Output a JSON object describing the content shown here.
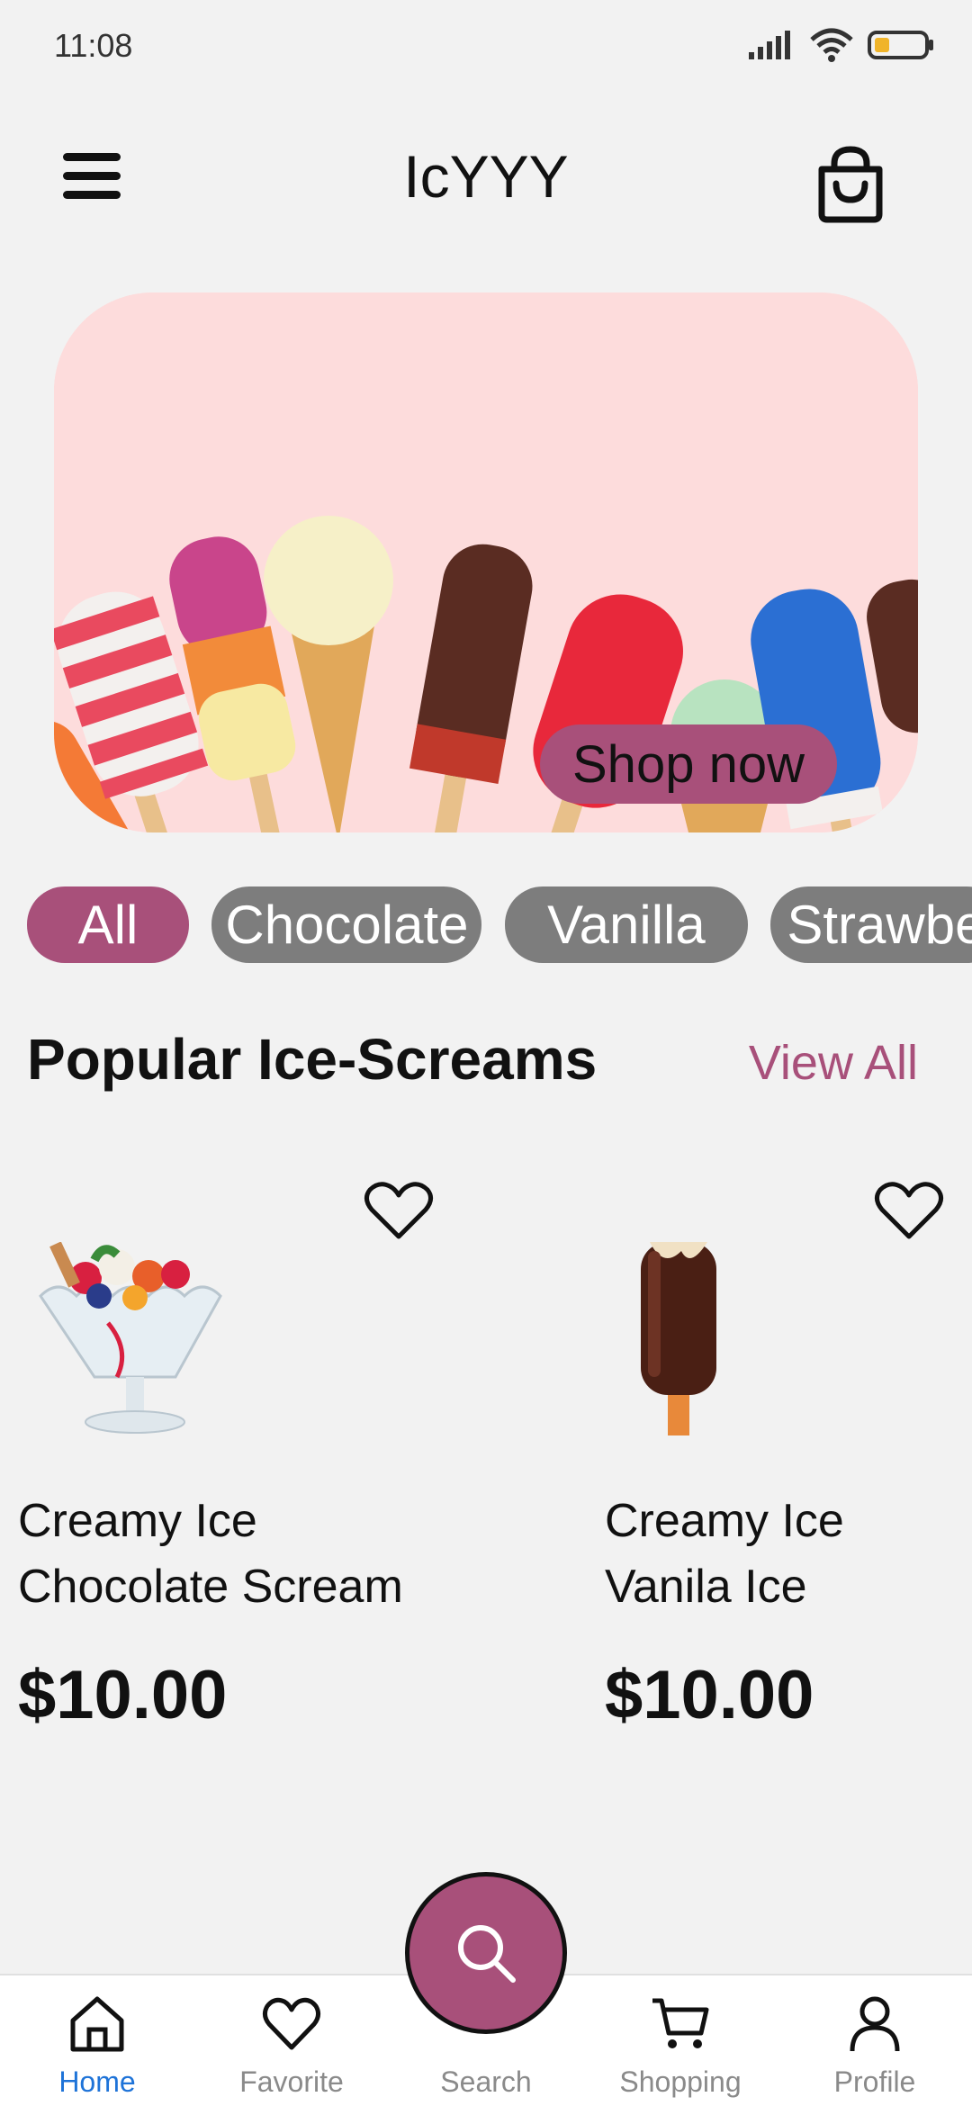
{
  "status": {
    "time": "11:08"
  },
  "header": {
    "title": "IcYYY"
  },
  "banner": {
    "cta": "Shop now"
  },
  "categories": [
    {
      "label": "All",
      "active": true
    },
    {
      "label": "Chocolate",
      "active": false
    },
    {
      "label": "Vanilla",
      "active": false
    },
    {
      "label": "Strawbe",
      "active": false
    }
  ],
  "section": {
    "title": "Popular Ice-Screams",
    "view_all": "View All"
  },
  "products": [
    {
      "name_line1": "Creamy Ice",
      "name_line2": "Chocolate Scream",
      "price": "$10.00",
      "image": "ice-cream-sundae"
    },
    {
      "name_line1": "Creamy Ice",
      "name_line2": "Vanila Ice",
      "price": "$10.00",
      "image": "chocolate-popsicle"
    }
  ],
  "nav": {
    "items": [
      {
        "label": "Home",
        "icon": "home-icon",
        "active": true
      },
      {
        "label": "Favorite",
        "icon": "heart-icon",
        "active": false
      },
      {
        "label": "Search",
        "icon": "search-icon",
        "active": false
      },
      {
        "label": "Shopping",
        "icon": "cart-icon",
        "active": false
      },
      {
        "label": "Profile",
        "icon": "user-icon",
        "active": false
      }
    ]
  },
  "colors": {
    "accent": "#a8507a",
    "background": "#f2f2f2",
    "nav_active": "#1e73d8",
    "chip_inactive": "#7d7d7d"
  }
}
